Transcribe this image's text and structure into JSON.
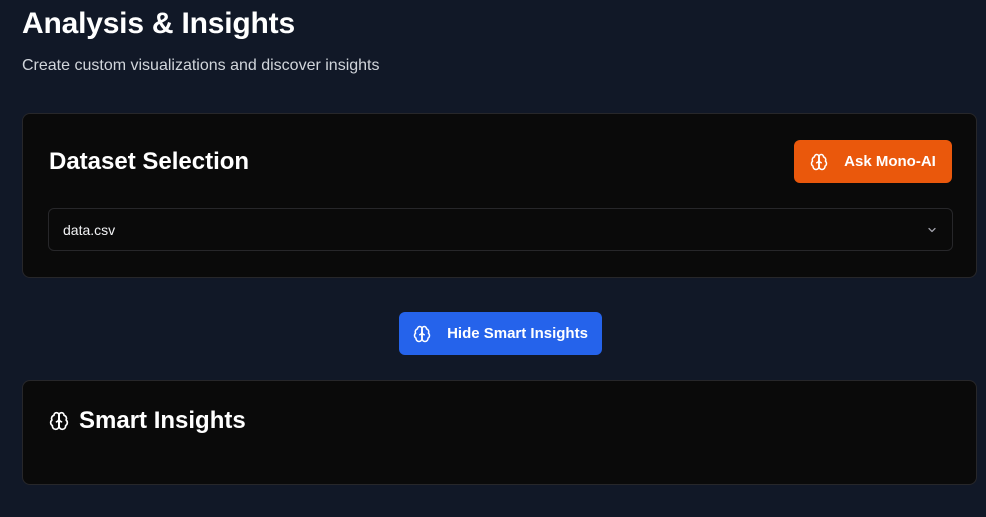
{
  "header": {
    "title": "Analysis & Insights",
    "subtitle": "Create custom visualizations and discover insights"
  },
  "dataset_card": {
    "title": "Dataset Selection",
    "ask_button_label": "Ask Mono-AI",
    "ask_button_icon": "brain-icon",
    "ask_button_color": "#ea580c",
    "selected_dataset": "data.csv",
    "select_icon": "chevron-down-icon"
  },
  "toggle": {
    "label": "Hide Smart Insights",
    "icon": "brain-icon",
    "color": "#2563eb"
  },
  "insights_card": {
    "title": "Smart Insights",
    "icon": "brain-icon"
  },
  "theme": {
    "background": "#111827",
    "card_background": "#0a0a0a",
    "border": "#27272a"
  }
}
